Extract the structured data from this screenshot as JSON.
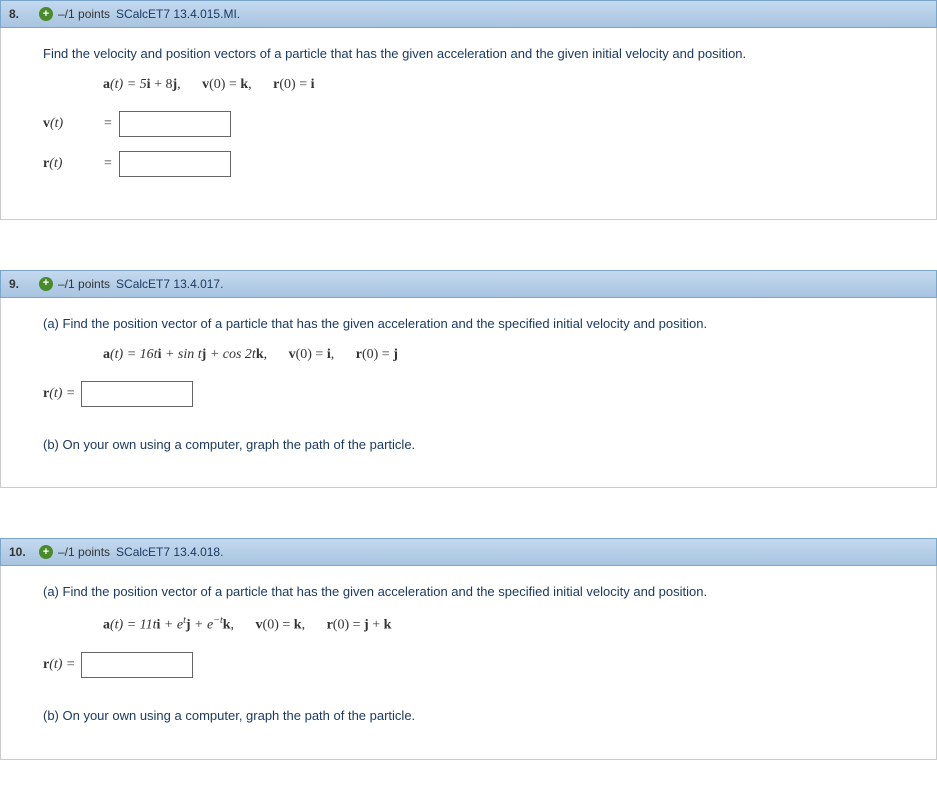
{
  "questions": [
    {
      "num": "8.",
      "points": "–/1 points",
      "ref": "SCalcET7 13.4.015.MI.",
      "prompt_a": "Find the velocity and position vectors of a particle that has the given acceleration and the given initial velocity and position.",
      "eq_parts": {
        "a_lhs": "a",
        "a_rhs": "(t) = 5",
        "a_i": "i",
        "a_plus": " + 8",
        "a_j": "j",
        "v_lhs": "v",
        "v_mid": "(0) = ",
        "v_k": "k",
        "r_lhs": "r",
        "r_mid": "(0) = ",
        "r_i": "i"
      },
      "answers": [
        {
          "label_vec": "v",
          "label_rest": "(t)"
        },
        {
          "label_vec": "r",
          "label_rest": "(t)"
        }
      ]
    },
    {
      "num": "9.",
      "points": "–/1 points",
      "ref": "SCalcET7 13.4.017.",
      "part_a_label": "(a) ",
      "prompt_a": "Find the position vector of a particle that has the given acceleration and the specified initial velocity and position.",
      "eq_parts": {
        "a_lhs": "a",
        "a_t": "(t) = 16t",
        "a_i": "i",
        "sin": " + sin t",
        "a_j": "j",
        "cos": " + cos 2t",
        "a_k": "k",
        "v_lhs": "v",
        "v_mid": "(0) = ",
        "v_i": "i",
        "r_lhs": "r",
        "r_mid": "(0) = ",
        "r_j": "j"
      },
      "answers": [
        {
          "label_vec": "r",
          "label_rest": "(t) ="
        }
      ],
      "part_b_label": "(b) ",
      "prompt_b": "On your own using a computer, graph the path of the particle."
    },
    {
      "num": "10.",
      "points": "–/1 points",
      "ref": "SCalcET7 13.4.018.",
      "part_a_label": "(a) ",
      "prompt_a": "Find the position vector of a particle that has the given acceleration and the specified initial velocity and position.",
      "eq_parts": {
        "a_lhs": "a",
        "a_t": "(t) = 11t",
        "a_i": "i",
        "e1": " + e",
        "sup1": "t",
        "a_j": "j",
        "e2": " + e",
        "sup2": "−t",
        "a_k": "k",
        "v_lhs": "v",
        "v_mid": "(0) = ",
        "v_k": "k",
        "r_lhs": "r",
        "r_mid": "(0) = ",
        "r_j": "j",
        "r_plus": " + ",
        "r_k": "k"
      },
      "answers": [
        {
          "label_vec": "r",
          "label_rest": "(t) ="
        }
      ],
      "part_b_label": "(b) ",
      "prompt_b": "On your own using a computer, graph the path of the particle."
    }
  ]
}
